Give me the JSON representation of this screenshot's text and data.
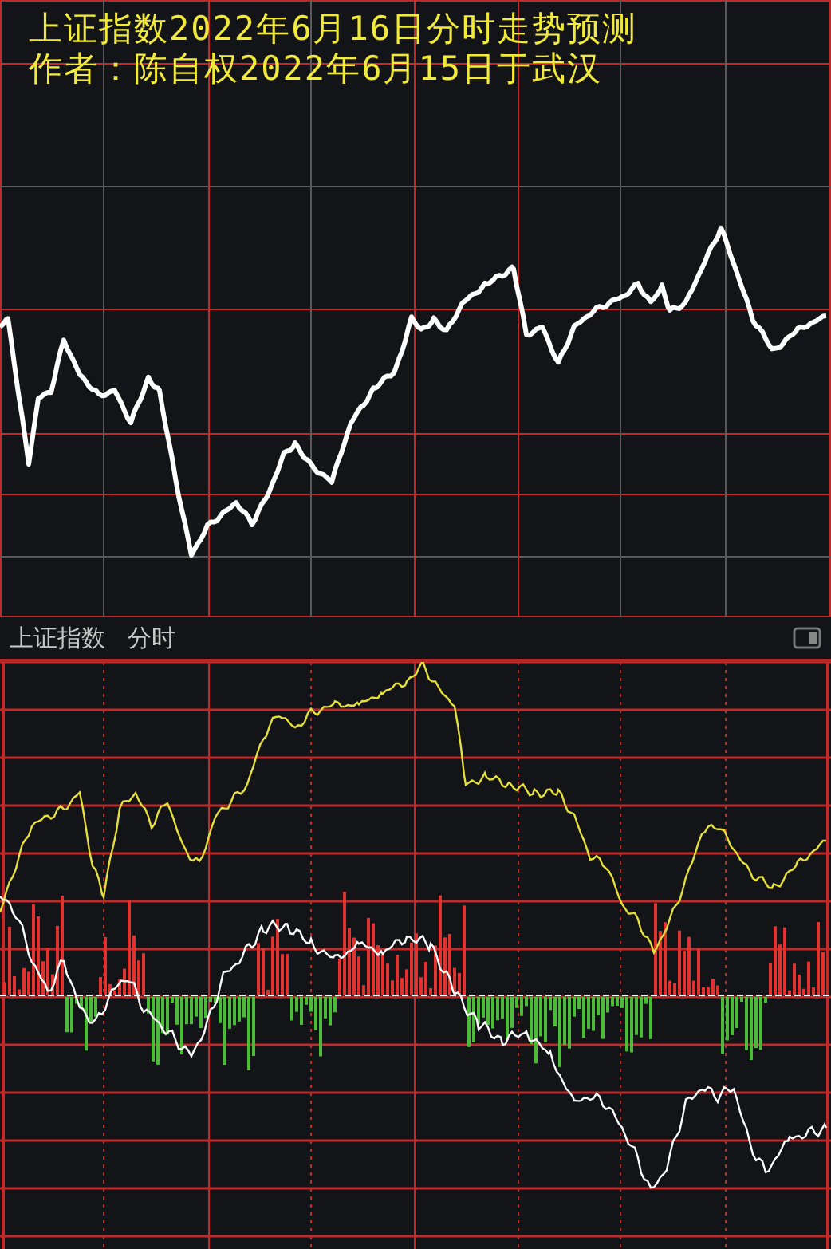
{
  "header": {
    "lines": [
      "上证指数2022年6月16日分时走势预测",
      "作者：陈自权2022年6月15日于武汉"
    ]
  },
  "toolbar": {
    "index_name": "上证指数",
    "view": "分时"
  }
}
